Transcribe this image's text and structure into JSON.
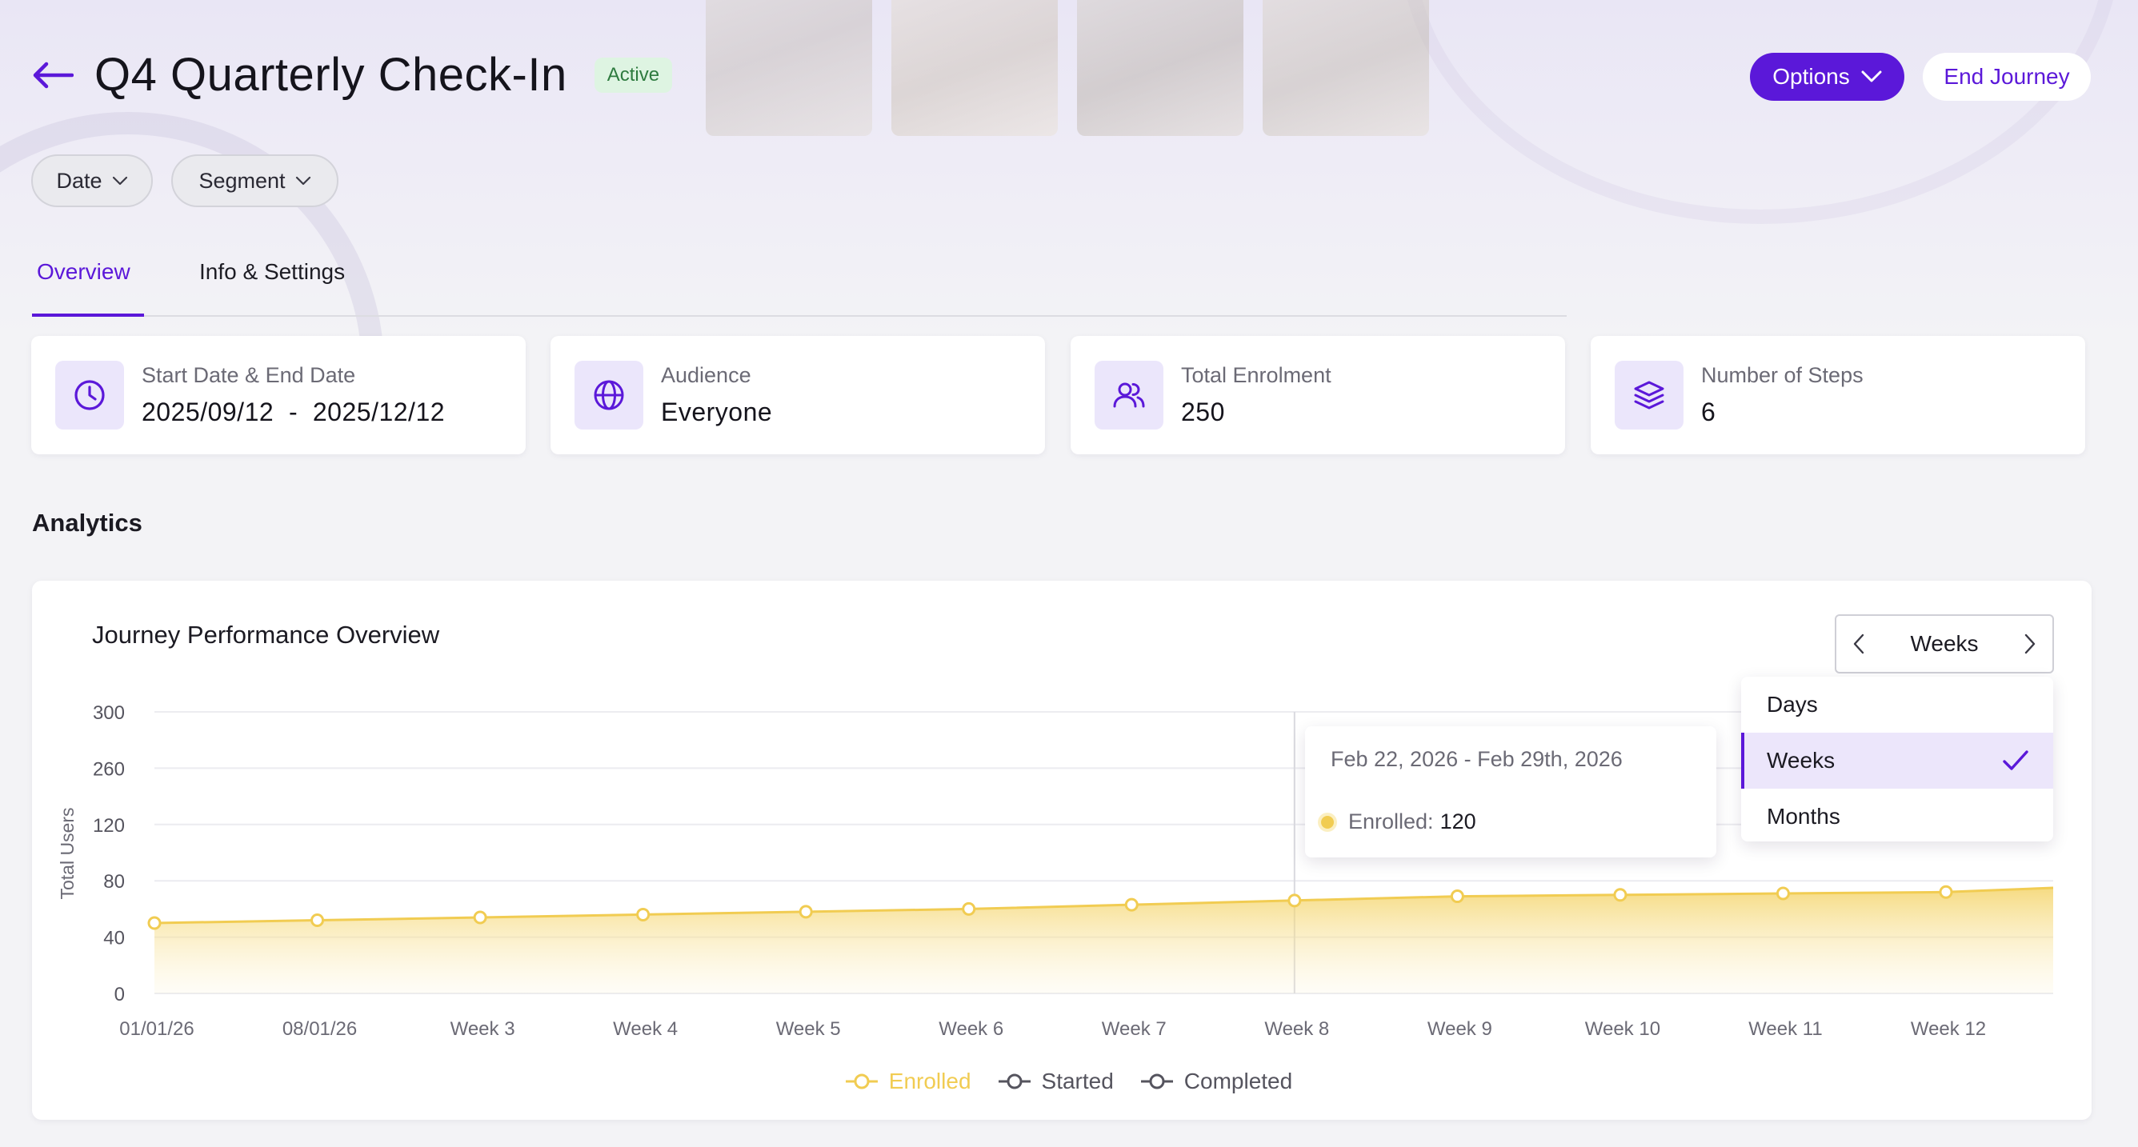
{
  "header": {
    "title": "Q4 Quarterly Check-In",
    "status": "Active",
    "options_label": "Options",
    "end_label": "End Journey"
  },
  "filters": {
    "date_label": "Date",
    "segment_label": "Segment"
  },
  "tabs": [
    {
      "label": "Overview",
      "active": true
    },
    {
      "label": "Info & Settings",
      "active": false
    }
  ],
  "cards": [
    {
      "label": "Start Date & End Date",
      "value": "2025/09/12  -  2025/12/12",
      "icon": "clock-icon"
    },
    {
      "label": "Audience",
      "value": "Everyone",
      "icon": "globe-icon"
    },
    {
      "label": "Total Enrolment",
      "value": "250",
      "icon": "users-icon"
    },
    {
      "label": "Number of Steps",
      "value": "6",
      "icon": "layers-icon"
    }
  ],
  "analytics_title": "Analytics",
  "chart_panel": {
    "title": "Journey Performance Overview",
    "period": "Weeks",
    "period_options": [
      "Days",
      "Weeks",
      "Months"
    ],
    "selected_period": "Weeks"
  },
  "tooltip": {
    "range": "Feb 22, 2026 - Feb 29th, 2026",
    "label": "Enrolled:",
    "value": "120"
  },
  "colors": {
    "accent": "#5b18d9",
    "enrolled": "#f1cc52",
    "started": "#55545e",
    "completed": "#55545e",
    "active_badge_bg": "#def4e2",
    "active_badge_text": "#2e7b3f"
  },
  "chart_data": {
    "type": "area",
    "title": "Journey Performance Overview",
    "xlabel": "",
    "ylabel": "Total Users",
    "y_ticks": [
      "300",
      "260",
      "120",
      "80",
      "40",
      "0"
    ],
    "categories": [
      "01/01/26",
      "08/01/26",
      "Week 3",
      "Week 4",
      "Week 5",
      "Week 6",
      "Week 7",
      "Week 8",
      "Week 9",
      "Week 10",
      "Week 11",
      "Week 12"
    ],
    "series": [
      {
        "name": "Enrolled",
        "values": [
          50,
          52,
          54,
          56,
          58,
          60,
          63,
          66,
          69,
          70,
          71,
          72
        ],
        "end_value": 75
      },
      {
        "name": "Started",
        "values": []
      },
      {
        "name": "Completed",
        "values": []
      }
    ],
    "grid": true,
    "legend_position": "bottom-center",
    "highlight_category": "Week 8"
  }
}
